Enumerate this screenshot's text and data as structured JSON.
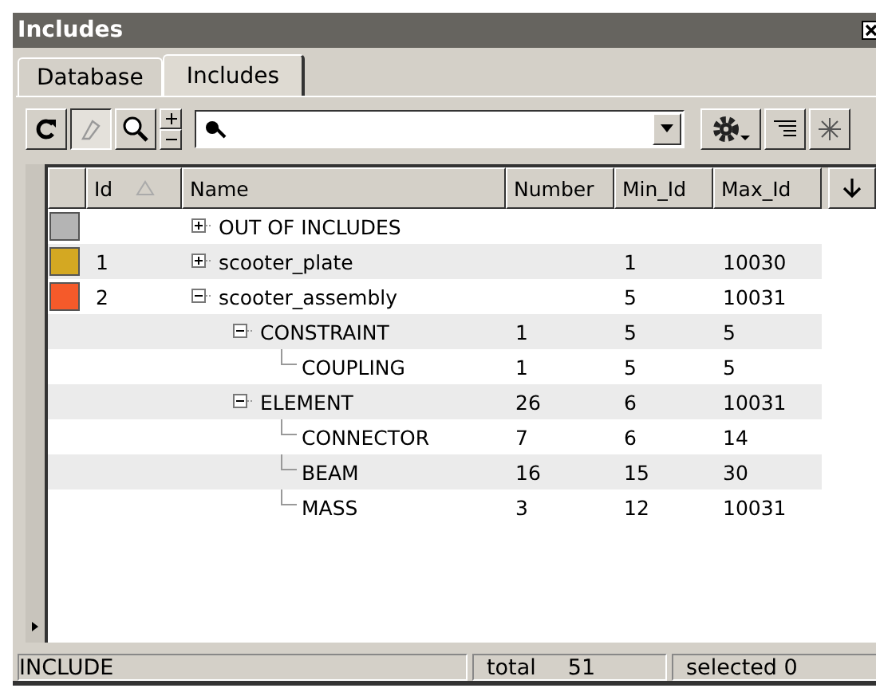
{
  "window": {
    "title": "Includes"
  },
  "tabs": [
    {
      "label": "Database",
      "selected": false
    },
    {
      "label": "Includes",
      "selected": true
    }
  ],
  "toolbar": {
    "paint_toggle_on": true
  },
  "table": {
    "columns": [
      "Id",
      "Name",
      "Number",
      "Min_Id",
      "Max_Id"
    ],
    "rows": [
      {
        "id": "",
        "name": "OUT OF INCLUDES",
        "number": "",
        "min_id": "",
        "max_id": "",
        "color": "#b4b4b4",
        "expanded": false,
        "children": []
      },
      {
        "id": "1",
        "name": "scooter_plate",
        "number": "",
        "min_id": "1",
        "max_id": "10030",
        "color": "#d4a822",
        "expanded": false,
        "children": []
      },
      {
        "id": "2",
        "name": "scooter_assembly",
        "number": "",
        "min_id": "5",
        "max_id": "10031",
        "color": "#f55a2a",
        "expanded": true,
        "children": [
          {
            "name": "CONSTRAINT",
            "number": "1",
            "min_id": "5",
            "max_id": "5",
            "expanded": true,
            "children": [
              {
                "name": "COUPLING",
                "number": "1",
                "min_id": "5",
                "max_id": "5"
              }
            ]
          },
          {
            "name": "ELEMENT",
            "number": "26",
            "min_id": "6",
            "max_id": "10031",
            "expanded": true,
            "children": [
              {
                "name": "CONNECTOR",
                "number": "7",
                "min_id": "6",
                "max_id": "14"
              },
              {
                "name": "BEAM",
                "number": "16",
                "min_id": "15",
                "max_id": "30"
              },
              {
                "name": "MASS",
                "number": "3",
                "min_id": "12",
                "max_id": "10031"
              }
            ]
          }
        ]
      }
    ]
  },
  "status_bar": {
    "mode": "INCLUDE",
    "total_label": "total",
    "total": "51",
    "selected": "selected 0"
  }
}
